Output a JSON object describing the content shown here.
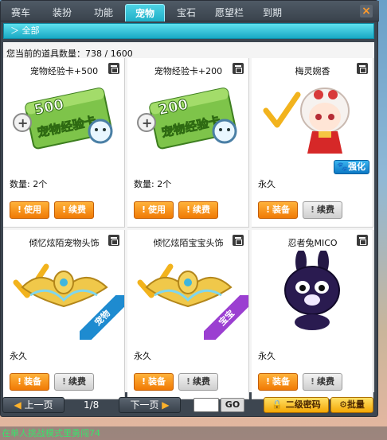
{
  "tabs": [
    {
      "label": "赛车",
      "active": false
    },
    {
      "label": "装扮",
      "active": false
    },
    {
      "label": "功能",
      "active": false
    },
    {
      "label": "宠物",
      "active": true
    },
    {
      "label": "宝石",
      "active": false
    },
    {
      "label": "愿望栏",
      "active": false
    },
    {
      "label": "到期",
      "active": false
    }
  ],
  "close_label": "×",
  "category": {
    "arrow": "＞",
    "label": "全部"
  },
  "inventory": {
    "label": "您当前的道具数量：",
    "value": "738 / 1600"
  },
  "items": [
    {
      "name": "宠物经验卡+500",
      "card_number": "500",
      "card_text": "宠物经验卡",
      "sub": "数量: 2个",
      "btn1": "使用",
      "btn2": "续费",
      "icon": "pet-exp-card-500"
    },
    {
      "name": "宠物经验卡+200",
      "card_number": "200",
      "card_text": "宠物经验卡",
      "sub": "数量: 2个",
      "btn1": "使用",
      "btn2": "续费",
      "icon": "pet-exp-card-200"
    },
    {
      "name": "梅灵婉香",
      "sub": "永久",
      "btn1": "装备",
      "btn2": "续费",
      "badge": "强化",
      "icon": "pet-girl-meilingwanxiang"
    },
    {
      "name": "倾忆炫陌宠物头饰",
      "sub": "永久",
      "btn1": "装备",
      "btn2": "续费",
      "tag": "宠物",
      "icon": "winged-crown-pet"
    },
    {
      "name": "倾忆炫陌宝宝头饰",
      "sub": "永久",
      "btn1": "装备",
      "btn2": "续费",
      "tag": "宝宝",
      "icon": "winged-crown-baby"
    },
    {
      "name": "忍者兔MICO",
      "sub": "永久",
      "btn1": "装备",
      "btn2": "续费",
      "icon": "ninja-rabbit-mico"
    }
  ],
  "footer": {
    "prev_label": "上一页",
    "page": "1/8",
    "next_label": "下一页",
    "go_label": "GO",
    "password_label": "二级密码",
    "batch_label": "批量"
  },
  "chat": {
    "text": "在单人挑战模式里勇闯74"
  },
  "colors": {
    "accent": "#1fb0c8",
    "orange": "#f07a05",
    "chat": "#39e36c"
  }
}
